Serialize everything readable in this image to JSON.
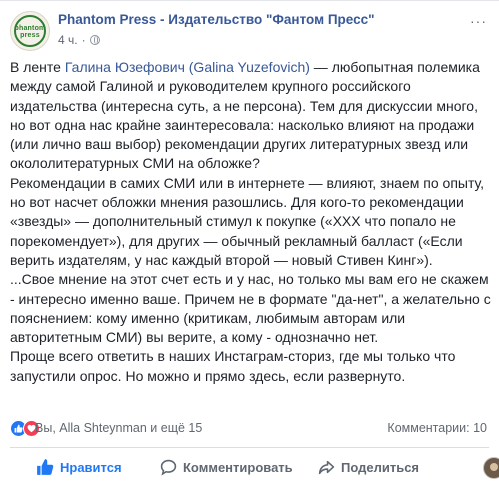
{
  "post": {
    "author": "Phantom Press - Издательство \"Фантом Пресс\"",
    "time": "4 ч.",
    "avatar_text": "phantom press",
    "more_label": "···",
    "text": {
      "p1_prefix": "В ленте ",
      "p1_link": "Галина Юзефович (Galina Yuzefovich)",
      "p1_rest": " — любопытная полемика между самой Галиной и руководителем крупного российского издательства (интересна суть, а не персона). Тем для дискуссии много, но вот одна нас крайне заинтересовала: насколько влияют на продажи (или лично ваш выбор) рекомендации других литературных звезд или окололитературных СМИ на обложке?",
      "p2": "Рекомендации в самих СМИ или в интернете — влияют, знаем по опыту, но вот насчет обложки мнения разошлись. Для кого-то рекомендации «звезды» — дополнительный стимул к покупке («ХХХ что попало не порекомендует»), для других — обычный рекламный балласт («Если верить издателям, у нас каждый второй — новый Стивен Кинг»).",
      "p3": " ...Свое мнение на этот счет есть и у нас, но только мы вам его не скажем - интересно именно ваше. Причем не в формате \"да-нет\", а желательно с пояснением: кому именно (критикам, любимым авторам или авторитетным СМИ) вы верите, а кому - однозначно нет.",
      "p4": "Проще всего ответить в наших Инстаграм-сториз, где мы только что запустили опрос. Но можно и прямо здесь, если развернуто."
    }
  },
  "reactions": {
    "reactors": "Вы, Alla Shteynman и ещё 15",
    "comments": "Комментарии: 10"
  },
  "actions": {
    "like": "Нравится",
    "comment": "Комментировать",
    "share": "Поделиться"
  },
  "colors": {
    "link": "#385898",
    "like_active": "#2078f4",
    "love": "#f33e58"
  }
}
